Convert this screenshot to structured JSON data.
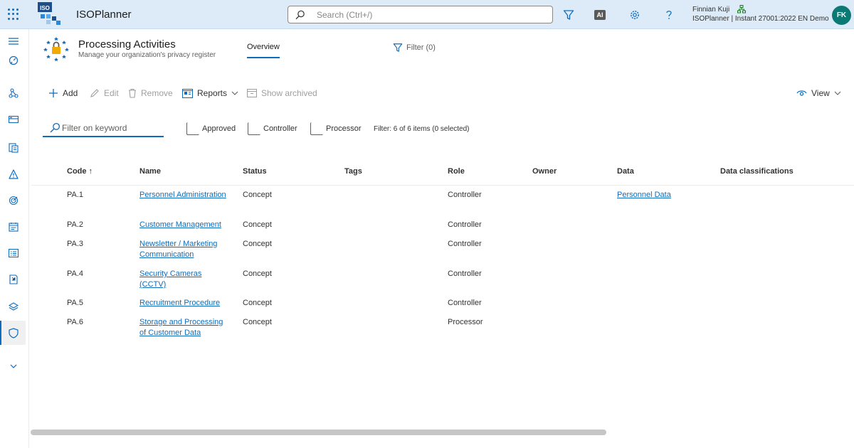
{
  "app": {
    "title": "ISOPlanner",
    "logo_text": "ISO"
  },
  "search": {
    "placeholder": "Search (Ctrl+/)"
  },
  "topbar": {
    "ai_label": "AI"
  },
  "user": {
    "name": "Finnian Kuji",
    "environment": "ISOPlanner | Instant 27001:2022 EN Demo",
    "initials": "FK"
  },
  "page": {
    "title": "Processing Activities",
    "subtitle": "Manage your organization's privacy register"
  },
  "tabs": {
    "overview": "Overview"
  },
  "filter_link": {
    "label": "Filter (0)"
  },
  "commands": {
    "add": "Add",
    "edit": "Edit",
    "remove": "Remove",
    "reports": "Reports",
    "show_archived": "Show archived",
    "view": "View"
  },
  "keyword_filter": {
    "placeholder": "Filter on keyword"
  },
  "checkboxes": {
    "approved": "Approved",
    "controller": "Controller",
    "processor": "Processor"
  },
  "filter_count": "Filter: 6 of 6 items (0 selected)",
  "columns": {
    "code": "Code ↑",
    "name": "Name",
    "status": "Status",
    "tags": "Tags",
    "role": "Role",
    "owner": "Owner",
    "data": "Data",
    "data_classifications": "Data classifications"
  },
  "rows": [
    {
      "code": "PA.1",
      "name": "Personnel Administration",
      "status": "Concept",
      "role": "Controller",
      "data": "Personnel Data"
    },
    {
      "code": "PA.2",
      "name": "Customer Management",
      "status": "Concept",
      "role": "Controller",
      "data": ""
    },
    {
      "code": "PA.3",
      "name": "Newsletter / Marketing Communication",
      "status": "Concept",
      "role": "Controller",
      "data": ""
    },
    {
      "code": "PA.4",
      "name": "Security Cameras (CCTV)",
      "status": "Concept",
      "role": "Controller",
      "data": ""
    },
    {
      "code": "PA.5",
      "name": "Recruitment Procedure",
      "status": "Concept",
      "role": "Controller",
      "data": ""
    },
    {
      "code": "PA.6",
      "name": "Storage and Processing of Customer Data",
      "status": "Concept",
      "role": "Processor",
      "data": ""
    }
  ],
  "colors": {
    "accent": "#0f6cbd",
    "topbar": "#dcebf7",
    "avatar": "#0b7a75",
    "link": "#0f6cbd"
  }
}
